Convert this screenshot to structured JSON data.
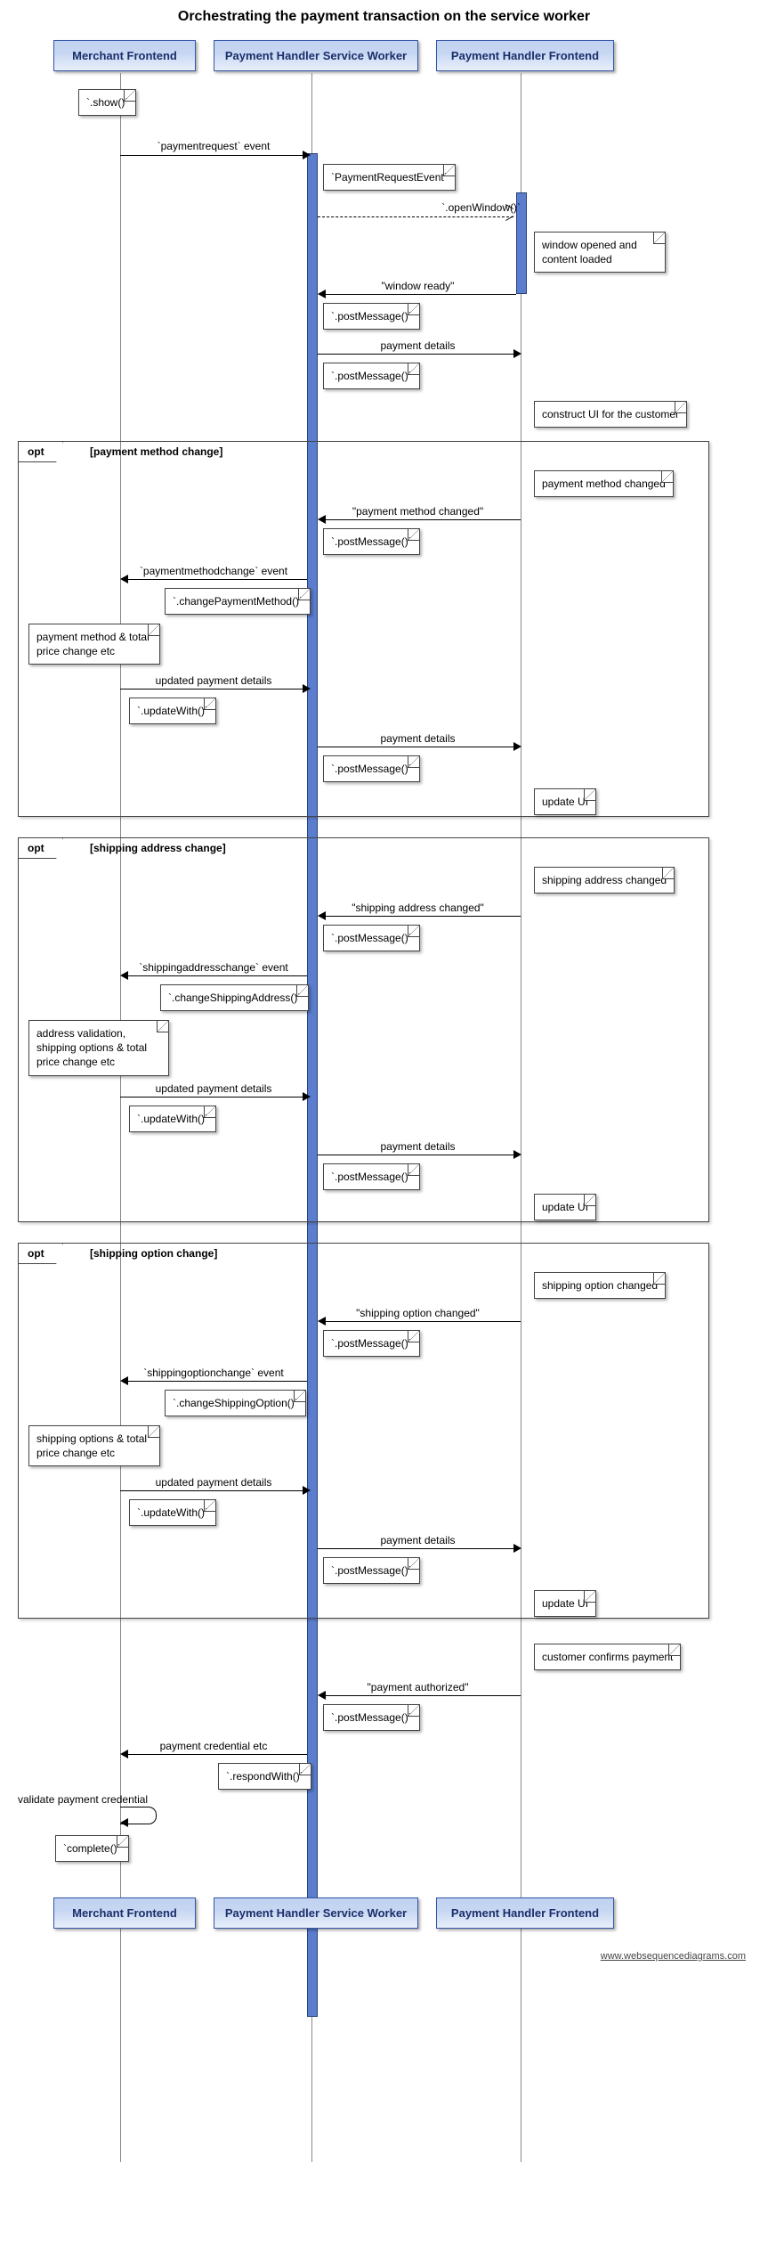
{
  "title": "Orchestrating the payment transaction on the service worker",
  "participants": {
    "merchant": "Merchant Frontend",
    "sw": "Payment Handler Service Worker",
    "fe": "Payment Handler Frontend"
  },
  "notes": {
    "show": "`.show()`",
    "paymentRequestEvent": "`PaymentRequestEvent`",
    "windowOpenedLoaded": "window opened and content loaded",
    "constructUI": "construct UI for the customer",
    "postMessage": "`.postMessage()`",
    "paymentMethodChanged": "payment method changed",
    "changePaymentMethod": "`.changePaymentMethod()`",
    "merchantPMChange": "payment method & total price change etc",
    "updateWith": "`.updateWith()`",
    "updateUI": "update UI",
    "shippingAddrChanged": "shipping address changed",
    "changeShippingAddress": "`.changeShippingAddress()`",
    "merchantAddrChange": "address validation, shipping options & total price change etc",
    "shippingOptChanged": "shipping option changed",
    "changeShippingOption": "`.changeShippingOption()`",
    "merchantOptChange": "shipping options & total price change etc",
    "customerConfirms": "customer confirms payment",
    "respondWith": "`.respondWith()`",
    "validateCredential": "validate payment credential",
    "complete": "`complete()`"
  },
  "messages": {
    "paymentrequestEvent": "`paymentrequest` event",
    "openWindow": "`.openWindow()`",
    "windowReady": "\"window ready\"",
    "paymentDetails": "payment details",
    "pmChanged": "\"payment method changed\"",
    "pmChangeEvent": "`paymentmethodchange` event",
    "updatedDetails": "updated payment details",
    "addrChanged": "\"shipping address changed\"",
    "addrChangeEvent": "`shippingaddresschange` event",
    "optChanged": "\"shipping option changed\"",
    "optChangeEvent": "`shippingoptionchange` event",
    "paymentAuthorized": "\"payment authorized\"",
    "paymentCredential": "payment credential etc"
  },
  "opt": {
    "kw": "opt",
    "pmChange": "[payment method change]",
    "addrChange": "[shipping address change]",
    "optChange": "[shipping option change]"
  },
  "footer": "www.websequencediagrams.com",
  "chart_data": {
    "type": "sequence-diagram",
    "title": "Orchestrating the payment transaction on the service worker",
    "participants": [
      {
        "id": "merchant",
        "name": "Merchant Frontend"
      },
      {
        "id": "sw",
        "name": "Payment Handler Service Worker"
      },
      {
        "id": "fe",
        "name": "Payment Handler Frontend"
      }
    ],
    "steps": [
      {
        "type": "note",
        "at": "merchant",
        "text": "`.show()`"
      },
      {
        "type": "message",
        "from": "merchant",
        "to": "sw",
        "label": "`paymentrequest` event"
      },
      {
        "type": "note",
        "at": "sw",
        "text": "`PaymentRequestEvent`"
      },
      {
        "type": "message",
        "from": "sw",
        "to": "fe",
        "label": "`.openWindow()`",
        "style": "dashed-open"
      },
      {
        "type": "note",
        "at": "fe",
        "side": "right",
        "text": "window opened and content loaded"
      },
      {
        "type": "message",
        "from": "fe",
        "to": "sw",
        "label": "\"window ready\""
      },
      {
        "type": "note",
        "at": "sw",
        "side": "right",
        "text": "`.postMessage()`"
      },
      {
        "type": "message",
        "from": "sw",
        "to": "fe",
        "label": "payment details"
      },
      {
        "type": "note",
        "at": "sw",
        "side": "right",
        "text": "`.postMessage()`"
      },
      {
        "type": "note",
        "at": "fe",
        "side": "right",
        "text": "construct UI for the customer"
      },
      {
        "type": "frame",
        "kind": "opt",
        "condition": "[payment method change]",
        "steps": [
          {
            "type": "note",
            "at": "fe",
            "side": "right",
            "text": "payment method changed"
          },
          {
            "type": "message",
            "from": "fe",
            "to": "sw",
            "label": "\"payment method changed\""
          },
          {
            "type": "note",
            "at": "sw",
            "side": "right",
            "text": "`.postMessage()`"
          },
          {
            "type": "message",
            "from": "sw",
            "to": "merchant",
            "label": "`paymentmethodchange` event"
          },
          {
            "type": "note",
            "at": "sw",
            "side": "left",
            "text": "`.changePaymentMethod()`"
          },
          {
            "type": "note",
            "at": "merchant",
            "side": "left",
            "text": "payment method & total price change etc"
          },
          {
            "type": "message",
            "from": "merchant",
            "to": "sw",
            "label": "updated payment details"
          },
          {
            "type": "note",
            "at": "merchant",
            "side": "right",
            "text": "`.updateWith()`"
          },
          {
            "type": "message",
            "from": "sw",
            "to": "fe",
            "label": "payment details"
          },
          {
            "type": "note",
            "at": "sw",
            "side": "right",
            "text": "`.postMessage()`"
          },
          {
            "type": "note",
            "at": "fe",
            "side": "right",
            "text": "update UI"
          }
        ]
      },
      {
        "type": "frame",
        "kind": "opt",
        "condition": "[shipping address change]",
        "steps": [
          {
            "type": "note",
            "at": "fe",
            "side": "right",
            "text": "shipping address changed"
          },
          {
            "type": "message",
            "from": "fe",
            "to": "sw",
            "label": "\"shipping address changed\""
          },
          {
            "type": "note",
            "at": "sw",
            "side": "right",
            "text": "`.postMessage()`"
          },
          {
            "type": "message",
            "from": "sw",
            "to": "merchant",
            "label": "`shippingaddresschange` event"
          },
          {
            "type": "note",
            "at": "sw",
            "side": "left",
            "text": "`.changeShippingAddress()`"
          },
          {
            "type": "note",
            "at": "merchant",
            "side": "left",
            "text": "address validation, shipping options & total price change etc"
          },
          {
            "type": "message",
            "from": "merchant",
            "to": "sw",
            "label": "updated payment details"
          },
          {
            "type": "note",
            "at": "merchant",
            "side": "right",
            "text": "`.updateWith()`"
          },
          {
            "type": "message",
            "from": "sw",
            "to": "fe",
            "label": "payment details"
          },
          {
            "type": "note",
            "at": "sw",
            "side": "right",
            "text": "`.postMessage()`"
          },
          {
            "type": "note",
            "at": "fe",
            "side": "right",
            "text": "update UI"
          }
        ]
      },
      {
        "type": "frame",
        "kind": "opt",
        "condition": "[shipping option change]",
        "steps": [
          {
            "type": "note",
            "at": "fe",
            "side": "right",
            "text": "shipping option changed"
          },
          {
            "type": "message",
            "from": "fe",
            "to": "sw",
            "label": "\"shipping option changed\""
          },
          {
            "type": "note",
            "at": "sw",
            "side": "right",
            "text": "`.postMessage()`"
          },
          {
            "type": "message",
            "from": "sw",
            "to": "merchant",
            "label": "`shippingoptionchange` event"
          },
          {
            "type": "note",
            "at": "sw",
            "side": "left",
            "text": "`.changeShippingOption()`"
          },
          {
            "type": "note",
            "at": "merchant",
            "side": "left",
            "text": "shipping options & total price change etc"
          },
          {
            "type": "message",
            "from": "merchant",
            "to": "sw",
            "label": "updated payment details"
          },
          {
            "type": "note",
            "at": "merchant",
            "side": "right",
            "text": "`.updateWith()`"
          },
          {
            "type": "message",
            "from": "sw",
            "to": "fe",
            "label": "payment details"
          },
          {
            "type": "note",
            "at": "sw",
            "side": "right",
            "text": "`.postMessage()`"
          },
          {
            "type": "note",
            "at": "fe",
            "side": "right",
            "text": "update UI"
          }
        ]
      },
      {
        "type": "note",
        "at": "fe",
        "side": "right",
        "text": "customer confirms payment"
      },
      {
        "type": "message",
        "from": "fe",
        "to": "sw",
        "label": "\"payment authorized\""
      },
      {
        "type": "note",
        "at": "sw",
        "side": "right",
        "text": "`.postMessage()`"
      },
      {
        "type": "message",
        "from": "sw",
        "to": "merchant",
        "label": "payment credential etc"
      },
      {
        "type": "note",
        "at": "sw",
        "side": "left",
        "text": "`.respondWith()`"
      },
      {
        "type": "self-message",
        "at": "merchant",
        "label": "validate payment credential"
      },
      {
        "type": "note",
        "at": "merchant",
        "side": "left",
        "text": "`complete()`"
      }
    ]
  }
}
